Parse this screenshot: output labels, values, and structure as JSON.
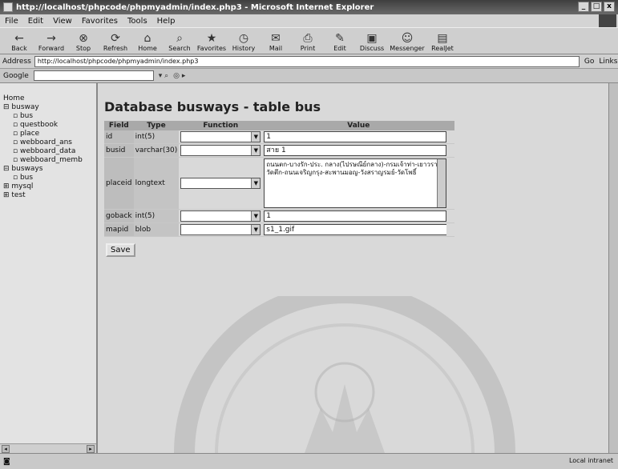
{
  "window": {
    "title": "http://localhost/phpcode/phpmyadmin/index.php3 - Microsoft Internet Explorer"
  },
  "menu": [
    "File",
    "Edit",
    "View",
    "Favorites",
    "Tools",
    "Help"
  ],
  "toolbar": [
    {
      "label": "Back",
      "icon": "back-arrow-icon"
    },
    {
      "label": "Forward",
      "icon": "forward-arrow-icon"
    },
    {
      "label": "Stop",
      "icon": "stop-icon"
    },
    {
      "label": "Refresh",
      "icon": "refresh-icon"
    },
    {
      "label": "Home",
      "icon": "home-icon"
    },
    {
      "label": "Search",
      "icon": "search-icon"
    },
    {
      "label": "Favorites",
      "icon": "favorites-icon"
    },
    {
      "label": "History",
      "icon": "history-icon"
    },
    {
      "label": "Mail",
      "icon": "mail-icon"
    },
    {
      "label": "Print",
      "icon": "print-icon"
    },
    {
      "label": "Edit",
      "icon": "edit-icon"
    },
    {
      "label": "Discuss",
      "icon": "discuss-icon"
    },
    {
      "label": "Messenger",
      "icon": "messenger-icon"
    },
    {
      "label": "RealJet",
      "icon": "realjet-icon"
    }
  ],
  "address": {
    "label": "Address",
    "value": "http://localhost/phpcode/phpmyadmin/index.php3",
    "go": "Go",
    "links": "Links"
  },
  "google": {
    "label": "Google"
  },
  "nav": {
    "home": "Home",
    "items": [
      {
        "label": "busway",
        "level": 0
      },
      {
        "label": "bus",
        "level": 1
      },
      {
        "label": "questbook",
        "level": 1
      },
      {
        "label": "place",
        "level": 1
      },
      {
        "label": "webboard_ans",
        "level": 1
      },
      {
        "label": "webboard_data",
        "level": 1
      },
      {
        "label": "webboard_memb",
        "level": 1
      },
      {
        "label": "busways",
        "level": 0
      },
      {
        "label": "bus",
        "level": 1
      },
      {
        "label": "mysql",
        "level": 0
      },
      {
        "label": "test",
        "level": 0
      }
    ]
  },
  "main": {
    "title": "Database busways - table bus",
    "headers": {
      "field": "Field",
      "type": "Type",
      "function": "Function",
      "value": "Value"
    },
    "rows": [
      {
        "field": "id",
        "type": "int(5)",
        "value": "1",
        "kind": "input"
      },
      {
        "field": "busid",
        "type": "varchar(30)",
        "value": "สาย 1",
        "kind": "input"
      },
      {
        "field": "placeid",
        "type": "longtext",
        "value": "ถนนตก-บางรัก-ประ. กลาง(ไปรษณีย์กลาง)-กรมเจ้าท่า-เยาวราช-วัดตึก-ถนนเจริญกรุง-สะพานมอญ-วังสราญรมย์-วัดโพธิ์",
        "kind": "textarea"
      },
      {
        "field": "goback",
        "type": "int(5)",
        "value": "1",
        "kind": "input"
      },
      {
        "field": "mapid",
        "type": "blob",
        "value": "s1_1.gif",
        "kind": "short"
      }
    ],
    "save_label": "Save"
  },
  "status": {
    "left": "",
    "zone": "Local intranet"
  }
}
